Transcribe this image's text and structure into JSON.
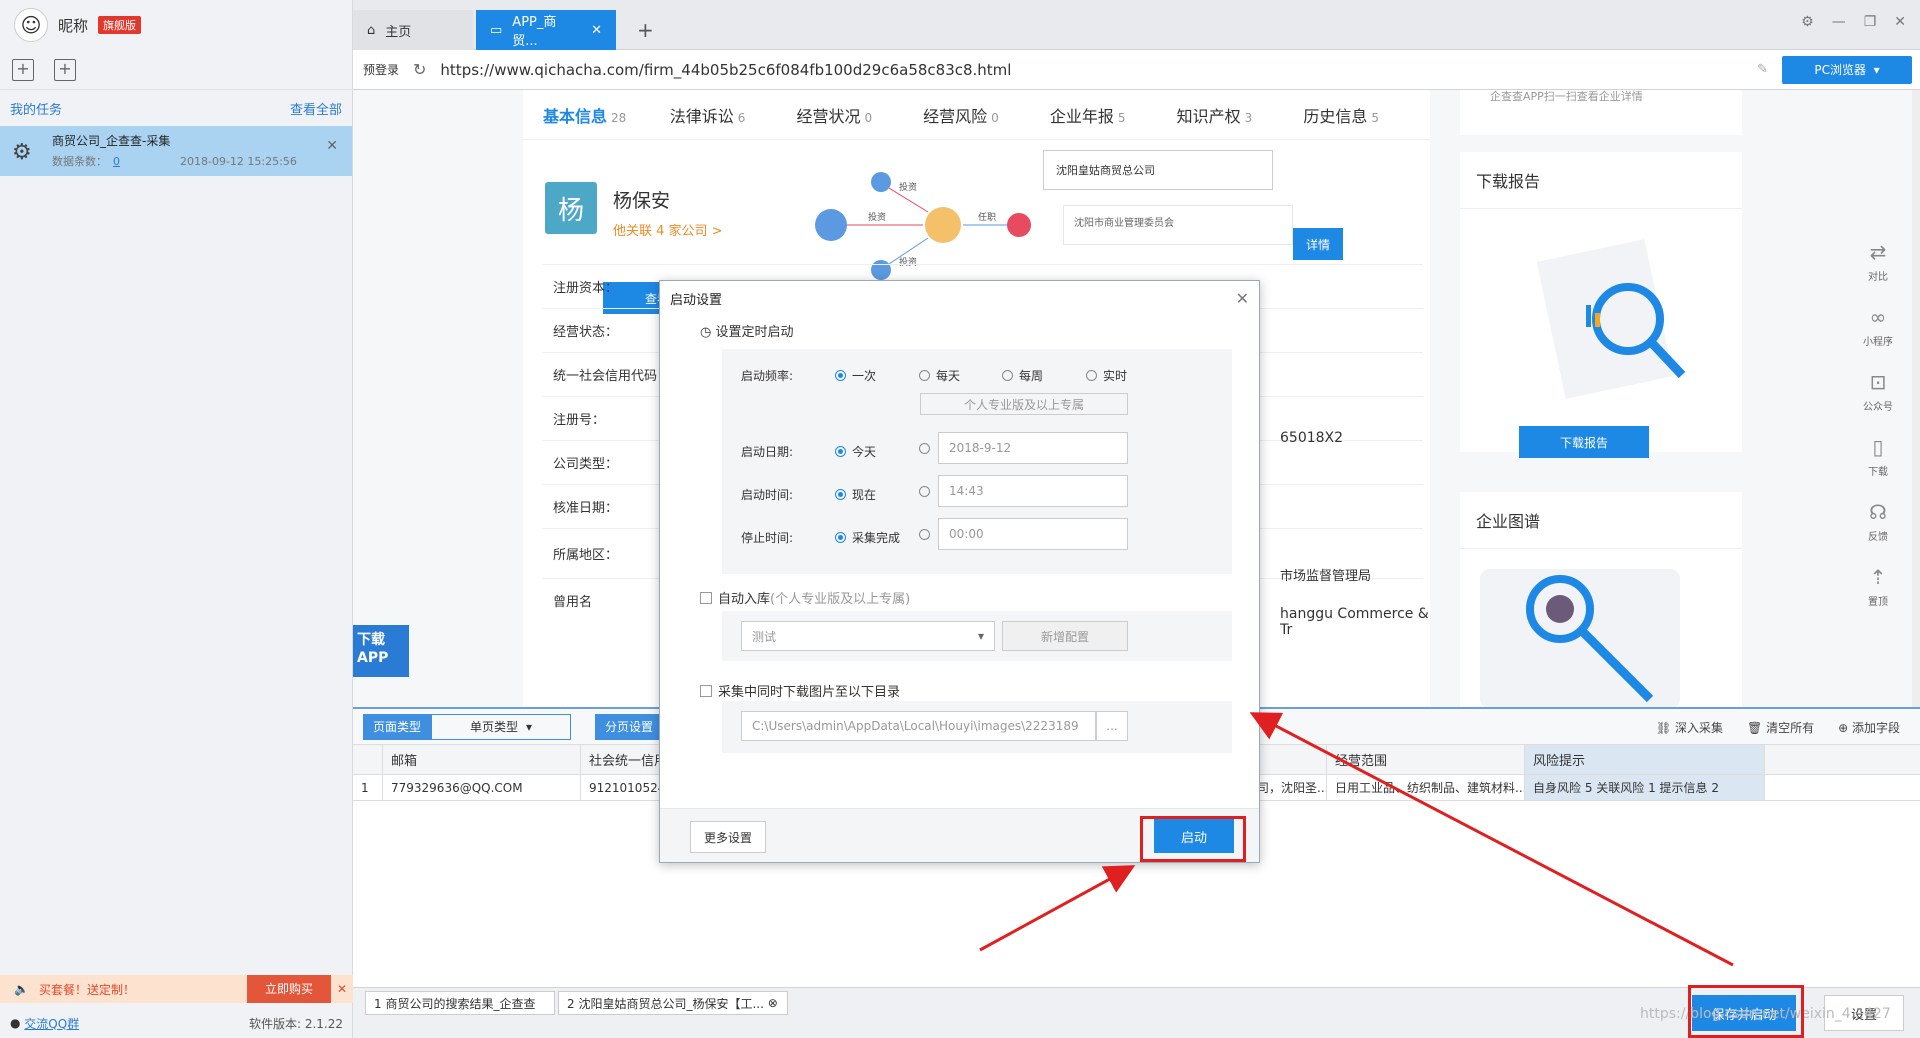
{
  "sidebar": {
    "nickname": "昵称",
    "vip_badge": "旗舰版",
    "my_tasks": "我的任务",
    "view_all": "查看全部",
    "task": {
      "title": "商贸公司_企查查-采集",
      "count_label": "数据条数：",
      "count": "0",
      "time": "2018-09-12 15:25:56"
    },
    "promo_text": "买套餐！送定制！",
    "promo_buy": "立即购买",
    "qq_group": "交流QQ群",
    "version": "软件版本: 2.1.22"
  },
  "tabs": [
    {
      "label": "主页"
    },
    {
      "label": "APP_商贸..."
    }
  ],
  "address": {
    "login": "预登录",
    "url": "https://www.qichacha.com/firm_44b05b25c6f084fb100d29c6a58c83c8.html",
    "pc_browser": "PC浏览器"
  },
  "web": {
    "nav": [
      {
        "label": "基本信息",
        "count": "28"
      },
      {
        "label": "法律诉讼",
        "count": "6"
      },
      {
        "label": "经营状况",
        "count": "0"
      },
      {
        "label": "经营风险",
        "count": "0"
      },
      {
        "label": "企业年报",
        "count": "5"
      },
      {
        "label": "知识产权",
        "count": "3"
      },
      {
        "label": "历史信息",
        "count": "5"
      }
    ],
    "owner_avatar": "杨",
    "owner_name": "杨保安",
    "owner_rel": "他关联 4 家公司 >",
    "btn_view": "查看人",
    "btn_detail": "详情",
    "graph_labels": [
      "投资",
      "投资",
      "任职",
      "投资",
      "任职"
    ],
    "company1": "沈阳皇姑商贸总公司",
    "company2": "沈阳市商业管理委员会",
    "info_rows": [
      "注册资本：",
      "经营状态：",
      "统一社会信用代码",
      "注册号：",
      "公司类型：",
      "核准日期：",
      "所属地区：",
      "曾用名"
    ],
    "reg_no_tail": "65018X2",
    "authority": "市场监督管理局",
    "eng_name": "hanggu Commerce & Tr",
    "download_report_title": "下载报告",
    "download_report_btn": "下载报告",
    "company_graph_title": "企业图谱",
    "top_cut_text": "企查查APP扫一扫查看企业详情",
    "rail": [
      "对比",
      "小程序",
      "公众号",
      "下载",
      "反馈",
      "置顶"
    ],
    "download_app": "下载 APP"
  },
  "grid": {
    "page_type_label": "页面类型",
    "page_type_value": "单页类型",
    "paging": "分页设置",
    "deep_collect": "深入采集",
    "clear_all": "清空所有",
    "add_field": "添加字段",
    "headers": [
      "",
      "邮箱",
      "社会统一信用",
      "曾用名",
      "经营范围",
      "风险提示"
    ],
    "row": [
      "1",
      "779329636@QQ.COM",
      "91210105243",
      "沈阳皇姑商贸集团总公司，沈阳圣...",
      "日用工业品、纺织制品、建筑材料...",
      "自身风险 5 关联风险 1 提示信息 2"
    ]
  },
  "status_tabs": [
    "1 商贸公司的搜索结果_企查查",
    "2 沈阳皇姑商贸总公司_杨保安【工..."
  ],
  "save_start": "保存并启动",
  "settings": "设置",
  "watermark": "https://blog.csdn.net/weixin_4...427",
  "modal": {
    "title": "启动设置",
    "timer_label": "设置定时启动",
    "freq_label": "启动频率:",
    "freq_options": [
      "一次",
      "每天",
      "每周",
      "实时"
    ],
    "freq_note": "个人专业版及以上专属",
    "date_label": "启动日期:",
    "date_today": "今天",
    "date_value": "2018-9-12",
    "time_label": "启动时间:",
    "time_now": "现在",
    "time_value": "14:43",
    "stop_label": "停止时间:",
    "stop_done": "采集完成",
    "stop_value": "00:00",
    "auto_db": "自动入库",
    "auto_db_note": "(个人专业版及以上专属)",
    "db_select": "测试",
    "db_new": "新增配置",
    "download_images": "采集中同时下载图片至以下目录",
    "image_path": "C:\\Users\\admin\\AppData\\Local\\Houyi\\images\\2223189",
    "browse": "...",
    "more_settings": "更多设置",
    "start": "启动"
  },
  "colors": {
    "accent": "#1e88e5",
    "annotation": "#e02020"
  }
}
